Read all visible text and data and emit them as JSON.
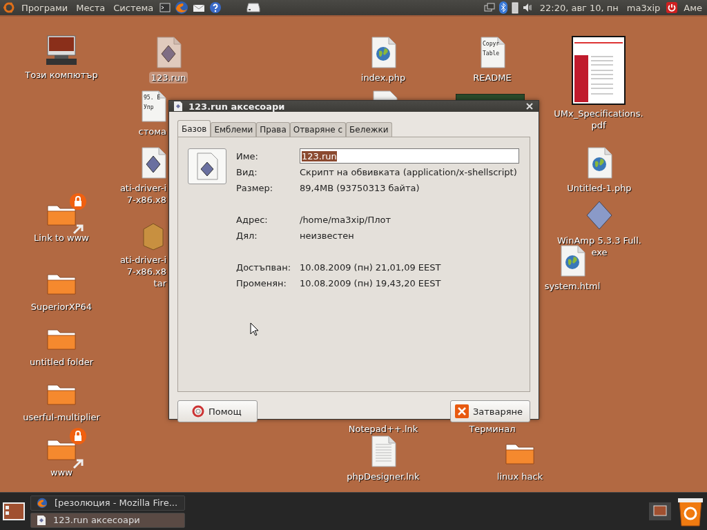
{
  "top_panel": {
    "menus": [
      "Програми",
      "Места",
      "Система"
    ],
    "clock": "22:20, авг 10, пн",
    "user": "ma3xip",
    "keyboard": "Аме"
  },
  "desktop_icons": [
    {
      "label": "Този компютър",
      "kind": "computer",
      "selected": false
    },
    {
      "label": "123.run",
      "kind": "script",
      "selected": true
    },
    {
      "label": "стома",
      "kind": "textdoc",
      "preview": [
        "95. E",
        "Упр"
      ],
      "selected": false
    },
    {
      "label": "ati-driver-i\n7-x86.x8",
      "kind": "script",
      "selected": false
    },
    {
      "label": "ati-driver-i\n7-x86.x8\ntar",
      "kind": "archive",
      "selected": false
    },
    {
      "label": "Link to www",
      "kind": "folder",
      "locked": true,
      "link": true,
      "selected": false
    },
    {
      "label": "SuperiorXP64",
      "kind": "folder",
      "selected": false
    },
    {
      "label": "untitled folder",
      "kind": "folder",
      "selected": false
    },
    {
      "label": "userful-multiplier",
      "kind": "folder",
      "selected": false
    },
    {
      "label": "www",
      "kind": "folder",
      "locked": true,
      "link": true,
      "selected": false
    },
    {
      "label": "index.php",
      "kind": "web",
      "selected": false
    },
    {
      "label": "README",
      "kind": "textdoc",
      "preview": [
        "Copyr",
        "Table"
      ],
      "selected": false
    },
    {
      "label": "UMx_Specifications.\npdf",
      "kind": "pdf",
      "selected": false
    },
    {
      "label": "Untitled-1.php",
      "kind": "web",
      "selected": false
    },
    {
      "label": "WinAmp 5.3.3 Full.\nexe",
      "kind": "exe",
      "selected": false
    },
    {
      "label": "system.html",
      "kind": "web",
      "selected": false
    },
    {
      "label": "Notepad++.lnk",
      "kind": "hidden",
      "selected": false
    },
    {
      "label": "Терминал",
      "kind": "hidden",
      "selected": false
    },
    {
      "label": "phpDesigner.lnk",
      "kind": "plaindoc",
      "selected": false
    },
    {
      "label": "linux hack",
      "kind": "folder",
      "selected": false
    }
  ],
  "dialog": {
    "title": "123.run аксесоари",
    "tabs": [
      {
        "label": "Базов",
        "selected": true
      },
      {
        "label": "Емблеми",
        "selected": false
      },
      {
        "label": "Права",
        "selected": false
      },
      {
        "label": "Отваряне с",
        "selected": false
      },
      {
        "label": "Бележки",
        "selected": false
      }
    ],
    "name_label": "Име:",
    "name_value": "123.run",
    "properties": [
      {
        "kind": "field",
        "label": "Вид:",
        "value": "Скрипт на обвивката (application/x-shellscript)"
      },
      {
        "kind": "field",
        "label": "Размер:",
        "value": "89,4MB (93750313 байта)"
      },
      {
        "kind": "gap"
      },
      {
        "kind": "field",
        "label": "Адрес:",
        "value": "/home/ma3xip/Плот"
      },
      {
        "kind": "field",
        "label": "Дял:",
        "value": "неизвестен"
      },
      {
        "kind": "gap"
      },
      {
        "kind": "field",
        "label": "Достъпван:",
        "value": "10.08.2009 (пн) 21,01,09 EEST"
      },
      {
        "kind": "field",
        "label": "Променян:",
        "value": "10.08.2009 (пн) 19,43,20 EEST"
      }
    ],
    "help_button": "Помощ",
    "close_button": "Затваряне"
  },
  "taskbar": [
    {
      "label": "[резолюция - Mozilla Fire...",
      "kind": "browser",
      "selected": false
    },
    {
      "label": "123.run аксесоари",
      "kind": "script",
      "selected": true
    }
  ]
}
